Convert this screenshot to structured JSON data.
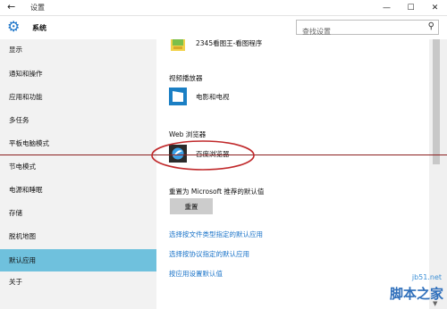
{
  "window": {
    "title": "设置",
    "back_icon": "arrow-left-icon",
    "controls": [
      "minimize-icon",
      "maximize-icon",
      "close-icon"
    ]
  },
  "header": {
    "title": "系统",
    "icon": "gear-icon",
    "search": {
      "placeholder": "查找设置",
      "value": "",
      "icon": "search-icon"
    }
  },
  "sidebar": {
    "items": [
      {
        "label": "显示"
      },
      {
        "label": "通知和操作"
      },
      {
        "label": "应用和功能"
      },
      {
        "label": "多任务"
      },
      {
        "label": "平板电脑模式"
      },
      {
        "label": "节电模式"
      },
      {
        "label": "电源和睡眠"
      },
      {
        "label": "存储"
      },
      {
        "label": "脱机地图"
      },
      {
        "label": "默认应用",
        "active": true
      },
      {
        "label": "关于"
      }
    ]
  },
  "main": {
    "photo_app": {
      "label": "2345看图王-看图程序"
    },
    "video_player": {
      "heading": "视频播放器",
      "app_label": "电影和电视"
    },
    "web_browser": {
      "heading": "Web 浏览器",
      "app_label": "百度浏览器"
    },
    "reset": {
      "heading": "重置为 Microsoft 推荐的默认值",
      "button": "重置"
    },
    "links": [
      {
        "label": "选择按文件类型指定的默认应用"
      },
      {
        "label": "选择按协议指定的默认应用"
      },
      {
        "label": "按应用设置默认值"
      }
    ]
  },
  "watermark": {
    "url": "jb51.net",
    "text": "脚本之家"
  },
  "colors": {
    "accent": "#1a73c8",
    "active_nav": "#6fc1dd",
    "sidebar_bg": "#f2f2f2",
    "annotation": "#c0282a"
  }
}
